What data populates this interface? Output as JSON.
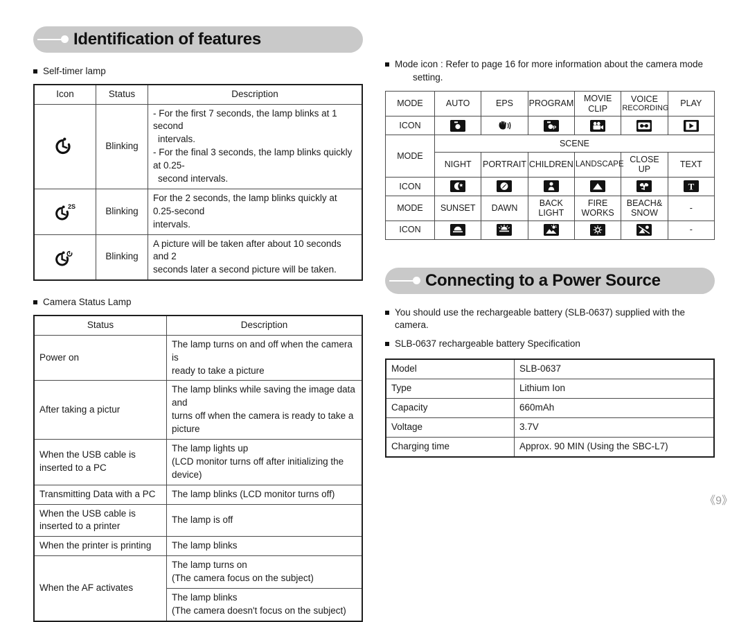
{
  "page": {
    "number": "《9》"
  },
  "sections": {
    "identification": {
      "title": "Identification of features"
    },
    "power": {
      "title": "Connecting to a Power Source"
    }
  },
  "self_timer": {
    "heading": "Self-timer lamp",
    "headers": [
      "Icon",
      "Status",
      "Description"
    ],
    "rows": [
      {
        "icon": "self-timer-10sec-icon",
        "status": "Blinking",
        "description_lines": [
          "- For the first 7 seconds, the lamp blinks at 1 second",
          "intervals.",
          "- For the final 3 seconds, the lamp blinks quickly at 0.25-",
          "second intervals."
        ]
      },
      {
        "icon": "self-timer-2sec-icon",
        "status": "Blinking",
        "description_lines": [
          "For the 2 seconds, the lamp blinks quickly at 0.25-second",
          "intervals."
        ]
      },
      {
        "icon": "self-timer-double-icon",
        "status": "Blinking",
        "description_lines": [
          "A picture will be taken after about 10 seconds and 2",
          "seconds later a second picture will be taken."
        ]
      }
    ]
  },
  "status_lamp": {
    "heading": "Camera Status Lamp",
    "headers": [
      "Status",
      "Description"
    ],
    "rows": [
      {
        "status": "Power on",
        "description_lines": [
          "The lamp turns on and off when the camera is",
          "ready to take a picture"
        ]
      },
      {
        "status": "After taking a pictur",
        "description_lines": [
          "The lamp blinks while saving the image data and",
          "turns off when the camera is ready to take a",
          "picture"
        ]
      },
      {
        "status_lines": [
          "When the USB cable is",
          "inserted to a PC"
        ],
        "description_lines": [
          "The lamp lights up",
          "(LCD monitor turns off after initializing the device)"
        ]
      },
      {
        "status": "Transmitting Data with a PC",
        "description_lines": [
          "The lamp blinks (LCD monitor turns off)"
        ]
      },
      {
        "status_lines": [
          "When the USB cable is",
          "inserted to a printer"
        ],
        "description_lines": [
          "The lamp is off"
        ]
      },
      {
        "status": "When the printer is printing",
        "description_lines": [
          "The lamp blinks"
        ]
      },
      {
        "status": "When the AF activates",
        "description_lines": [
          "The lamp turns on",
          "(The camera focus on the subject)"
        ],
        "description_lines2": [
          "The lamp blinks",
          "(The camera doesn't focus on the subject)"
        ]
      }
    ]
  },
  "mode_icons": {
    "note_line1": "Mode icon : Refer to page 16 for more information about the camera mode",
    "note_line2": "setting.",
    "row_label_mode": "MODE",
    "row_label_icon": "ICON",
    "scene_label": "SCENE",
    "group1": {
      "modes": [
        {
          "label": "AUTO",
          "label2": "",
          "icon": "camera-icon"
        },
        {
          "label": "EPS",
          "label2": "",
          "icon": "hand-shake-icon"
        },
        {
          "label": "PROGRAM",
          "label2": "",
          "icon": "camera-program-icon"
        },
        {
          "label": "MOVIE",
          "label2": "CLIP",
          "icon": "movie-camera-icon"
        },
        {
          "label": "VOICE",
          "label2": "RECORDING",
          "icon": "voice-cassette-icon"
        },
        {
          "label": "PLAY",
          "label2": "",
          "icon": "play-icon"
        }
      ]
    },
    "group2": {
      "modes": [
        {
          "label": "NIGHT",
          "label2": "",
          "icon": "moon-star-icon"
        },
        {
          "label": "PORTRAIT",
          "label2": "",
          "icon": "portrait-face-icon"
        },
        {
          "label": "CHILDREN",
          "label2": "",
          "icon": "children-person-icon"
        },
        {
          "label": "LANDSCAPE",
          "label2": "",
          "icon": "mountain-icon"
        },
        {
          "label": "CLOSE",
          "label2": "UP",
          "icon": "flower-macro-icon"
        },
        {
          "label": "TEXT",
          "label2": "",
          "icon": "text-t-icon"
        }
      ]
    },
    "group3": {
      "modes": [
        {
          "label": "SUNSET",
          "label2": "",
          "icon": "sunset-icon"
        },
        {
          "label": "DAWN",
          "label2": "",
          "icon": "dawn-sun-icon"
        },
        {
          "label": "BACK",
          "label2": "LIGHT",
          "icon": "backlight-icon"
        },
        {
          "label": "FIRE",
          "label2": "WORKS",
          "icon": "fireworks-icon"
        },
        {
          "label": "BEACH&",
          "label2": "SNOW",
          "icon": "beach-snow-icon"
        },
        {
          "label": "-",
          "label2": "",
          "icon": "none"
        }
      ]
    }
  },
  "power_source": {
    "note1": "You should use the rechargeable battery (SLB-0637) supplied with the camera.",
    "note2": "SLB-0637 rechargeable battery Specification",
    "spec_rows": [
      {
        "key": "Model",
        "value": "SLB-0637"
      },
      {
        "key": "Type",
        "value": "Lithium Ion"
      },
      {
        "key": "Capacity",
        "value": "660mAh"
      },
      {
        "key": "Voltage",
        "value": "3.7V"
      },
      {
        "key": "Charging time",
        "value": "Approx. 90 MIN (Using the SBC-L7)"
      }
    ]
  }
}
